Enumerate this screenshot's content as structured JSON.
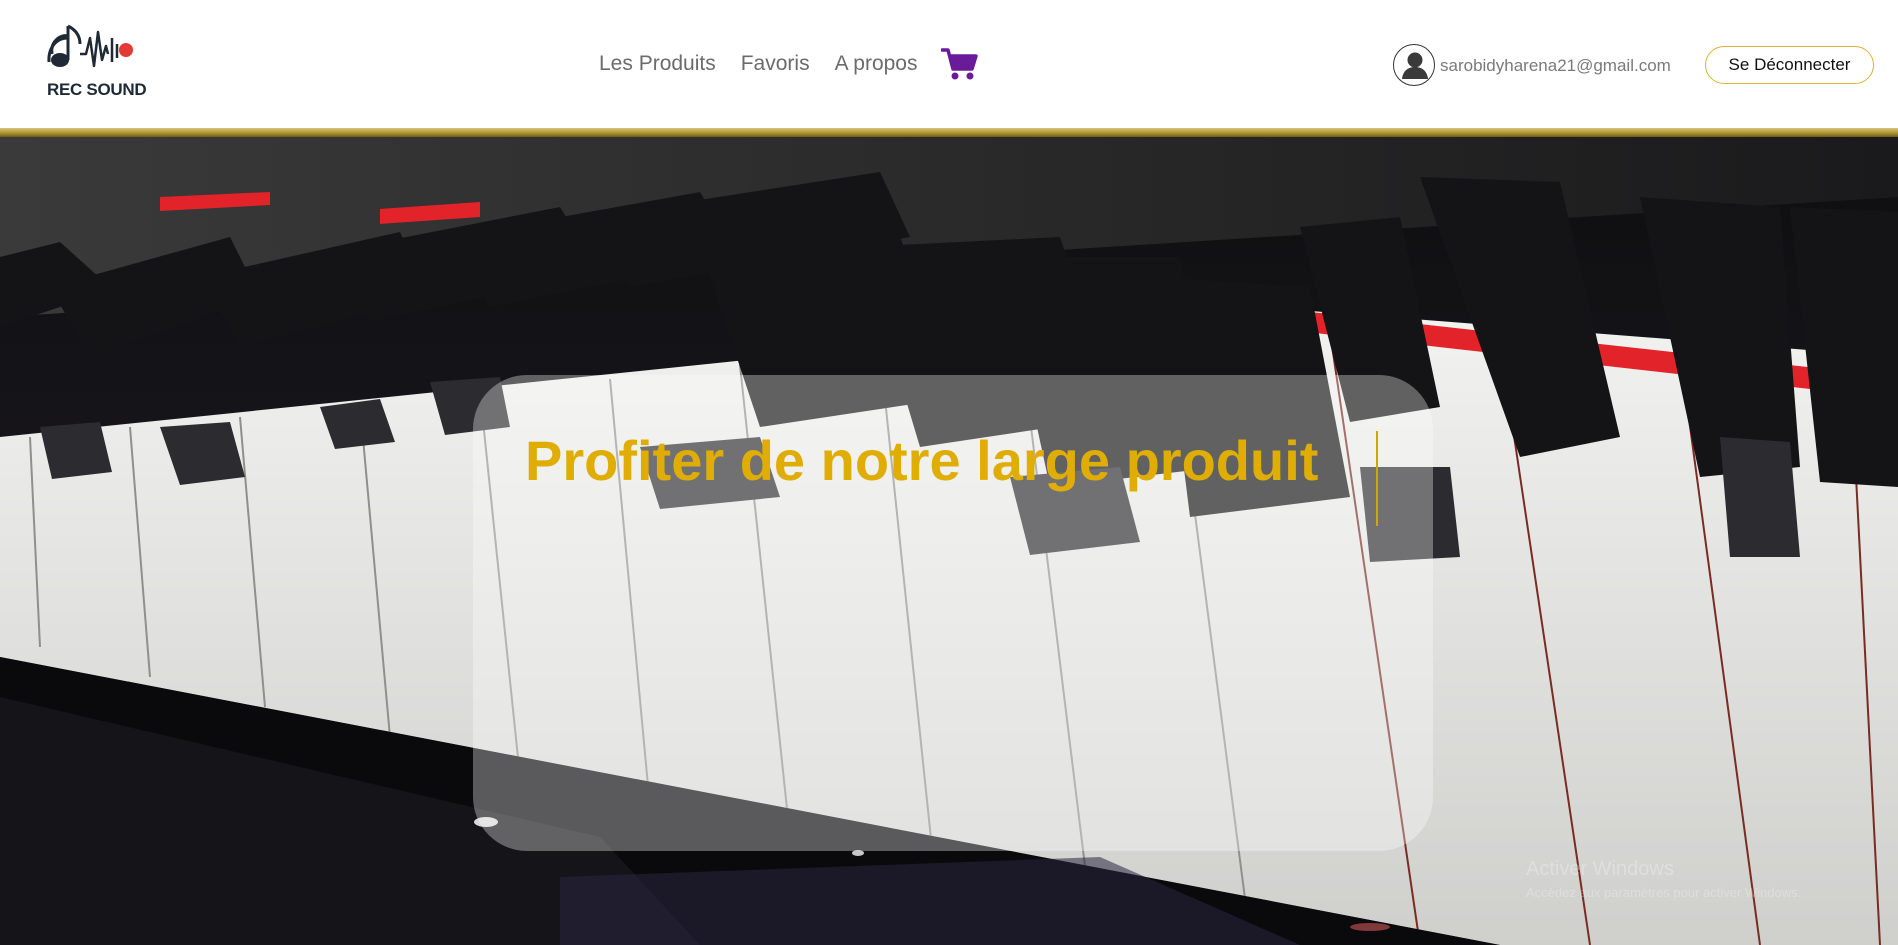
{
  "brand": {
    "name": "REC SOUND",
    "dot_color": "#e53935"
  },
  "nav": {
    "items": [
      {
        "label": "Les Produits"
      },
      {
        "label": "Favoris"
      },
      {
        "label": "A propos"
      }
    ],
    "cart_icon": "shopping-cart-icon",
    "cart_color": "#6a1b9a"
  },
  "user": {
    "avatar_icon": "user-icon",
    "email": "sarobidyharena21@gmail.com",
    "logout_label": "Se Déconnecter"
  },
  "theme": {
    "accent_gold": "#e0ad05",
    "divider_gold": "#b09532"
  },
  "hero": {
    "background": "piano keys photo",
    "title": "Profiter de notre large produit"
  },
  "watermark": {
    "line1": "Activer Windows",
    "line2": "Accédez aux paramètres pour activer Windows."
  }
}
